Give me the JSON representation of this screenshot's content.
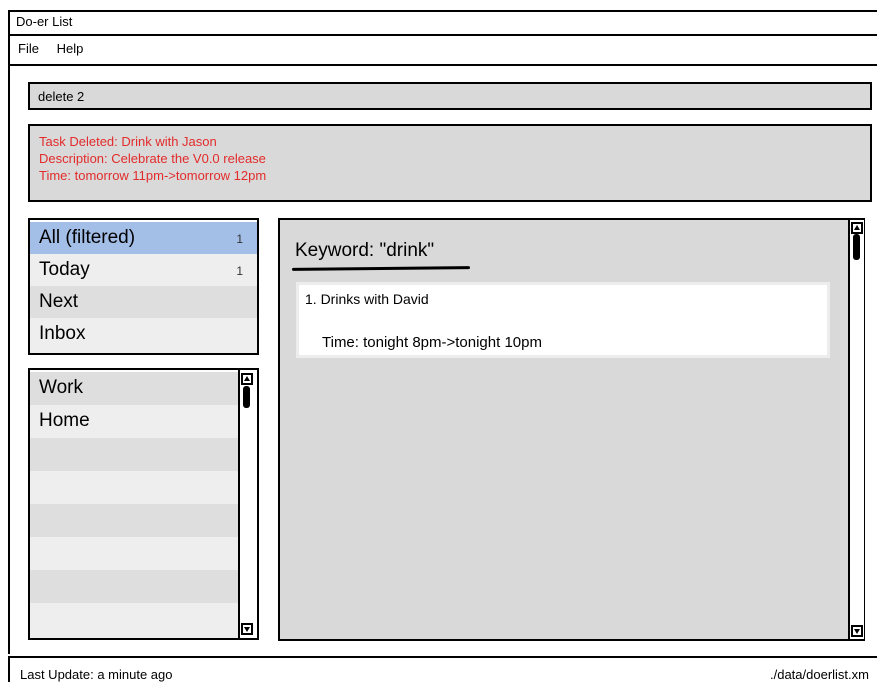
{
  "window": {
    "title": "Do-er List"
  },
  "menu": {
    "items": [
      "File",
      "Help"
    ]
  },
  "command_input": {
    "value": "delete 2"
  },
  "feedback": {
    "lines": [
      "Task Deleted: Drink with Jason",
      "Description: Celebrate the V0.0 release",
      "Time: tomorrow 11pm->tomorrow 12pm"
    ],
    "color": "#e32b2b"
  },
  "categories": [
    {
      "label": "All (filtered)",
      "count": "1"
    },
    {
      "label": "Today",
      "count": "1"
    },
    {
      "label": "Next",
      "count": ""
    },
    {
      "label": "Inbox",
      "count": ""
    }
  ],
  "tags": [
    "Work",
    "Home"
  ],
  "main": {
    "heading": "Keyword: \"drink\"",
    "tasks": [
      {
        "title": "1. Drinks with David",
        "time": "Time: tonight 8pm->tonight 10pm"
      }
    ]
  },
  "status": {
    "last_update": "Last Update: a minute ago",
    "file_path": "./data/doerlist.xm"
  },
  "colors": {
    "selected_category": "#a3bfe8",
    "panel_bg": "#d9d9d9"
  }
}
